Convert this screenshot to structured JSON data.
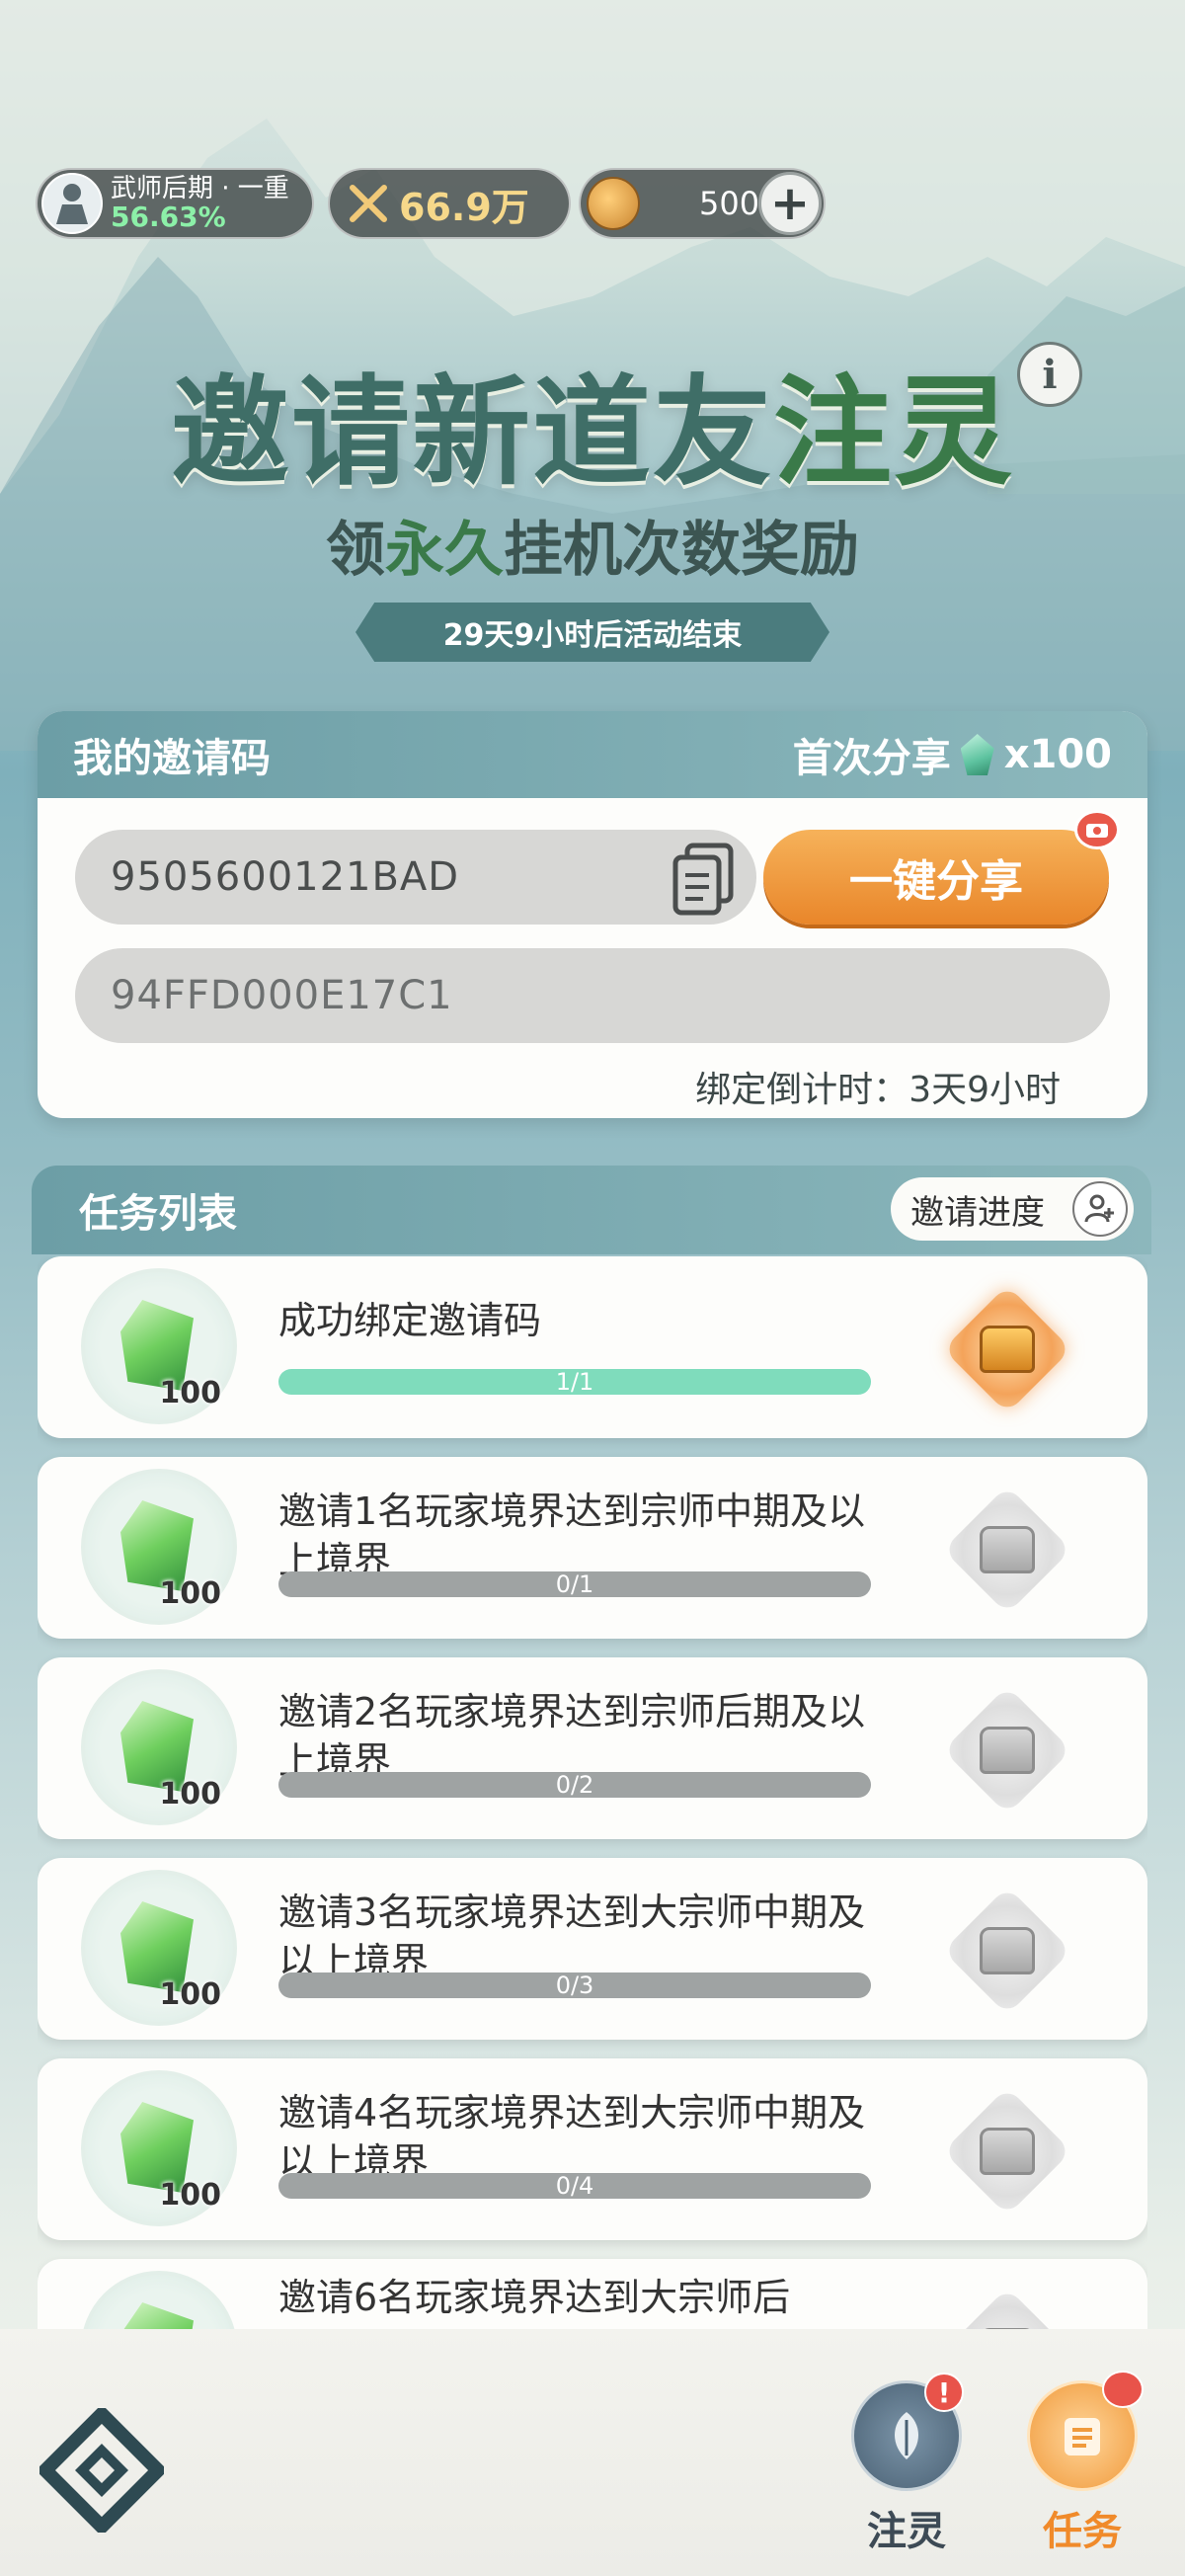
{
  "status_bar": {
    "realm_name": "武师后期 · 一重",
    "realm_progress": "56.63%",
    "power": "66.9万",
    "coins": "500",
    "plus_icon": "plus-icon"
  },
  "banner": {
    "title_main": "邀请新道友",
    "title_accent": "注灵",
    "subtitle_before": "领",
    "subtitle_accent": "永久",
    "subtitle_after": "挂机次数奖励",
    "countdown": "29天9小时后活动结束",
    "info_label": "i"
  },
  "invite": {
    "header": "我的邀请码",
    "first_share_label": "首次分享",
    "first_share_amount": "x100",
    "code": "9505600121BAD",
    "share_button": "一键分享",
    "bind_code": "94FFD000E17C1",
    "bind_countdown_label": "绑定倒计时：",
    "bind_countdown_value": "3天9小时"
  },
  "tasks": {
    "header": "任务列表",
    "progress_button": "邀请进度",
    "items": [
      {
        "title": "成功绑定邀请码",
        "progress_text": "1/1",
        "progress": 1.0,
        "reward": "100",
        "chest": "active"
      },
      {
        "title": "邀请1名玩家境界达到宗师中期及以上境界",
        "progress_text": "0/1",
        "progress": 0,
        "reward": "100",
        "chest": "locked"
      },
      {
        "title": "邀请2名玩家境界达到宗师后期及以上境界",
        "progress_text": "0/2",
        "progress": 0,
        "reward": "100",
        "chest": "locked"
      },
      {
        "title": "邀请3名玩家境界达到大宗师中期及以上境界",
        "progress_text": "0/3",
        "progress": 0,
        "reward": "100",
        "chest": "locked"
      },
      {
        "title": "邀请4名玩家境界达到大宗师中期及以上境界",
        "progress_text": "0/4",
        "progress": 0,
        "reward": "100",
        "chest": "locked"
      },
      {
        "title": "邀请6名玩家境界达到大宗师后",
        "progress_text": "",
        "progress": 0,
        "reward": "",
        "chest": "locked"
      }
    ]
  },
  "nav": {
    "zhuling": "注灵",
    "zhuling_badge": "!",
    "task": "任务"
  },
  "colors": {
    "accent_orange": "#e9862a",
    "header_teal": "#6c9ea6",
    "progress_green": "#7fdcbc"
  }
}
